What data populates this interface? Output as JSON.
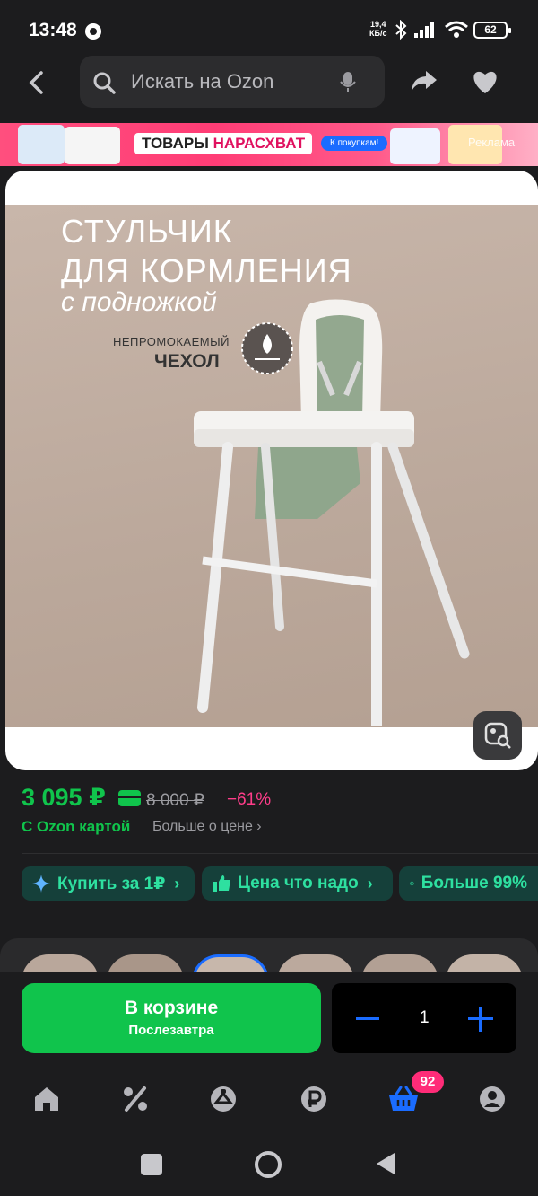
{
  "status": {
    "time": "13:48",
    "net_speed_top": "19,4",
    "net_speed_bottom": "КБ/с",
    "battery": "62"
  },
  "search": {
    "placeholder": "Искать на Ozon"
  },
  "banner": {
    "pill_left": "ТОВАРЫ ",
    "pill_right": "НАРАСХВАТ",
    "cta": "К покупкам!",
    "ad_label": "Реклама"
  },
  "product_image": {
    "title_line1": "СТУЛЬЧИК",
    "title_line2": "ДЛЯ КОРМЛЕНИЯ",
    "subtitle": "с подножкой",
    "tag_line1": "НЕПРОМОКАЕМЫЙ",
    "tag_line2": "ЧЕХОЛ"
  },
  "price": {
    "current": "3 095 ₽",
    "old": "8 000 ₽",
    "discount": "−61%",
    "card_label": "С Ozon картой",
    "more_label": "Больше о цене ›"
  },
  "chips": [
    {
      "label": "Купить за 1₽",
      "icon": "sparkle-icon"
    },
    {
      "label": "Цена что надо",
      "icon": "thumbs-up-icon"
    },
    {
      "label": "Больше 99%",
      "icon": "return-icon"
    }
  ],
  "cart": {
    "label": "В корзине",
    "sub": "Послезавтра",
    "qty": "1"
  },
  "nav": {
    "cart_badge": "92"
  },
  "colors": {
    "accent_green": "#10c44c",
    "accent_blue": "#1a6cff",
    "discount_pink": "#ff3d8a",
    "chip_text": "#2ee0a0"
  }
}
